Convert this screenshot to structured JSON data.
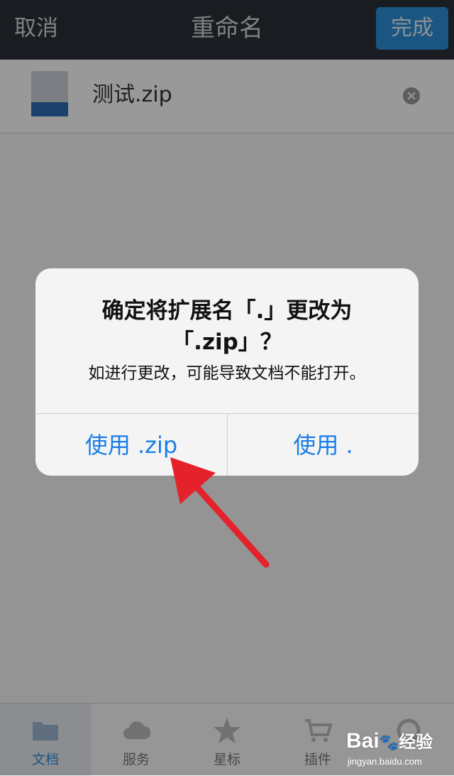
{
  "navbar": {
    "cancel_label": "取消",
    "title": "重命名",
    "done_label": "完成"
  },
  "file": {
    "name": "测试.zip"
  },
  "tabs": [
    {
      "label": "文档",
      "icon": "folder-icon",
      "active": true
    },
    {
      "label": "服务",
      "icon": "cloud-icon",
      "active": false
    },
    {
      "label": "星标",
      "icon": "star-icon",
      "active": false
    },
    {
      "label": "插件",
      "icon": "cart-icon",
      "active": false
    },
    {
      "label": "",
      "icon": "settings-icon",
      "active": false
    }
  ],
  "alert": {
    "title_line1": "确定将扩展名「.」更改为",
    "title_line2": "「.zip」？",
    "message": "如进行更改，可能导致文档不能打开。",
    "use_zip_label": "使用 .zip",
    "use_dot_label": "使用 ."
  },
  "watermark": {
    "brand": "Bai",
    "brand_suffix": "经验",
    "url": "jingyan.baidu.com"
  },
  "colors": {
    "navbar_bg": "#2b3036",
    "accent": "#2c8fd8",
    "alert_button": "#1a7ee6",
    "arrow": "#e5212b"
  }
}
